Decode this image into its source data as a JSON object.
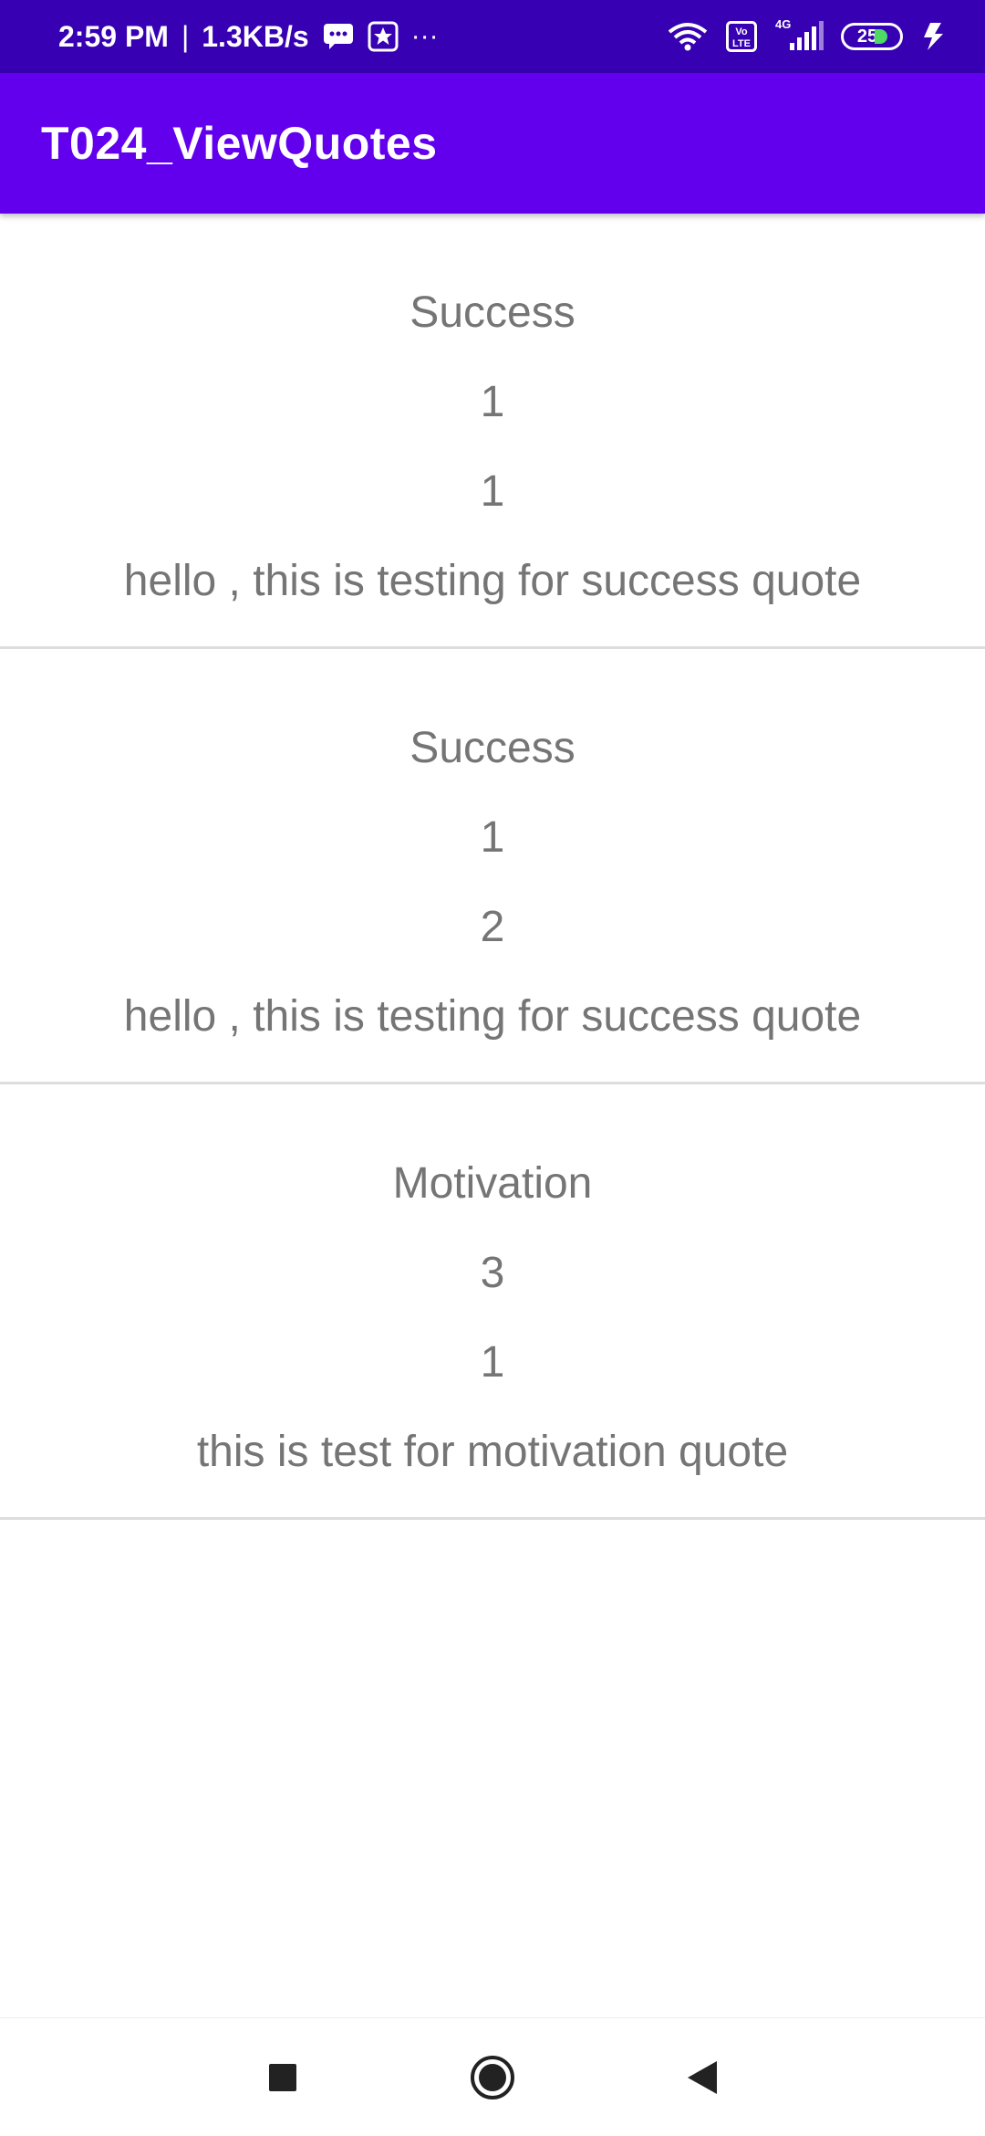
{
  "status_bar": {
    "time": "2:59 PM",
    "separator": "|",
    "speed": "1.3KB/s",
    "more": "···",
    "network": "4G",
    "battery": "25",
    "icons": [
      "message-icon",
      "star-app-icon",
      "wifi-icon",
      "volte-icon",
      "signal-icon",
      "battery-icon",
      "charging-icon"
    ]
  },
  "app_bar": {
    "title": "T024_ViewQuotes"
  },
  "quotes": [
    {
      "category": "Success",
      "line2": "1",
      "line3": "1",
      "text": "hello , this is testing for success quote"
    },
    {
      "category": "Success",
      "line2": "1",
      "line3": "2",
      "text": "hello , this is testing for success quote"
    },
    {
      "category": "Motivation",
      "line2": "3",
      "line3": "1",
      "text": "this is test for motivation quote"
    }
  ],
  "nav_bar": {
    "icons": [
      "recents-square-icon",
      "home-circle-icon",
      "back-triangle-icon"
    ]
  },
  "colors": {
    "status_bar": "#3700b3",
    "app_bar": "#6200ee",
    "text": "#757575",
    "divider": "#dddddd"
  }
}
